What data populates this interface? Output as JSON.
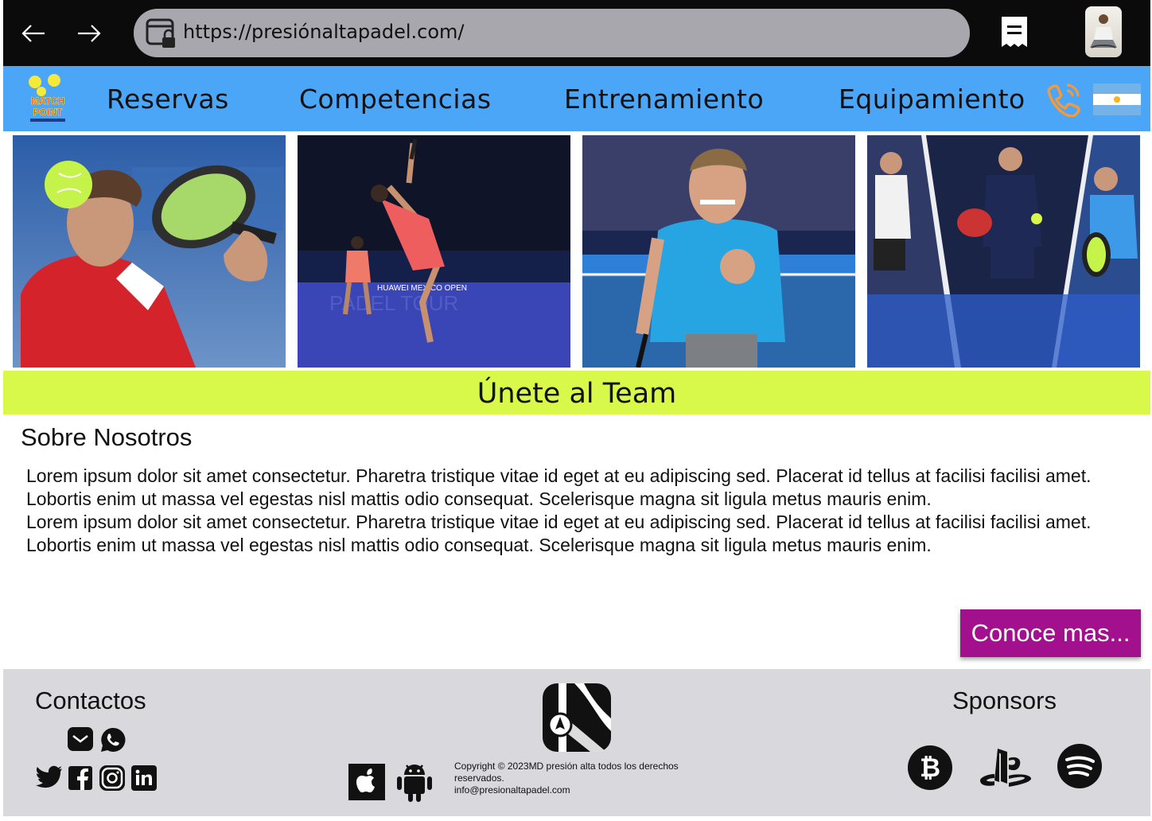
{
  "browser": {
    "url": "https://presiónaltapadel.com/",
    "icons": [
      "back-arrow-icon",
      "forward-arrow-icon",
      "site-lock-icon",
      "reader-mode-icon",
      "user-avatar"
    ]
  },
  "nav": {
    "logo_text": "MATCH POINT",
    "items": [
      "Reservas",
      "Competencias",
      "Entrenamiento",
      "Equipamiento"
    ],
    "icons": [
      "phone-icon",
      "argentina-flag-icon"
    ]
  },
  "gallery": {
    "photos": [
      "padel-player-red-shirt",
      "padel-player-jumping",
      "padel-player-celebrating",
      "padel-players-collage"
    ]
  },
  "banner": {
    "text": "Únete al Team"
  },
  "about": {
    "title": "Sobre Nosotros",
    "paragraphs": [
      "Lorem ipsum dolor sit amet consectetur. Pharetra tristique vitae id eget at eu adipiscing sed. Placerat id tellus at facilisi facilisi amet. Lobortis enim ut massa vel egestas nisl mattis odio consequat. Scelerisque magna sit ligula metus mauris enim.",
      "Lorem ipsum dolor sit amet consectetur. Pharetra tristique vitae id eget at eu adipiscing sed. Placerat id tellus at facilisi facilisi amet. Lobortis enim ut massa vel egestas nisl mattis odio consequat. Scelerisque magna sit ligula metus mauris enim."
    ],
    "cta_label": "Conoce mas..."
  },
  "footer": {
    "contacts_title": "Contactos",
    "sponsors_title": "Sponsors",
    "copyright_lines": [
      "Copyright © 2023MD presión alta todos los derechos reservados.",
      "info@presionaltapadel.com"
    ],
    "colors": {
      "nav": "#4ca6f8",
      "banner": "#d8f84a",
      "cta": "#a3108d",
      "footer": "#d8d8dd"
    }
  }
}
